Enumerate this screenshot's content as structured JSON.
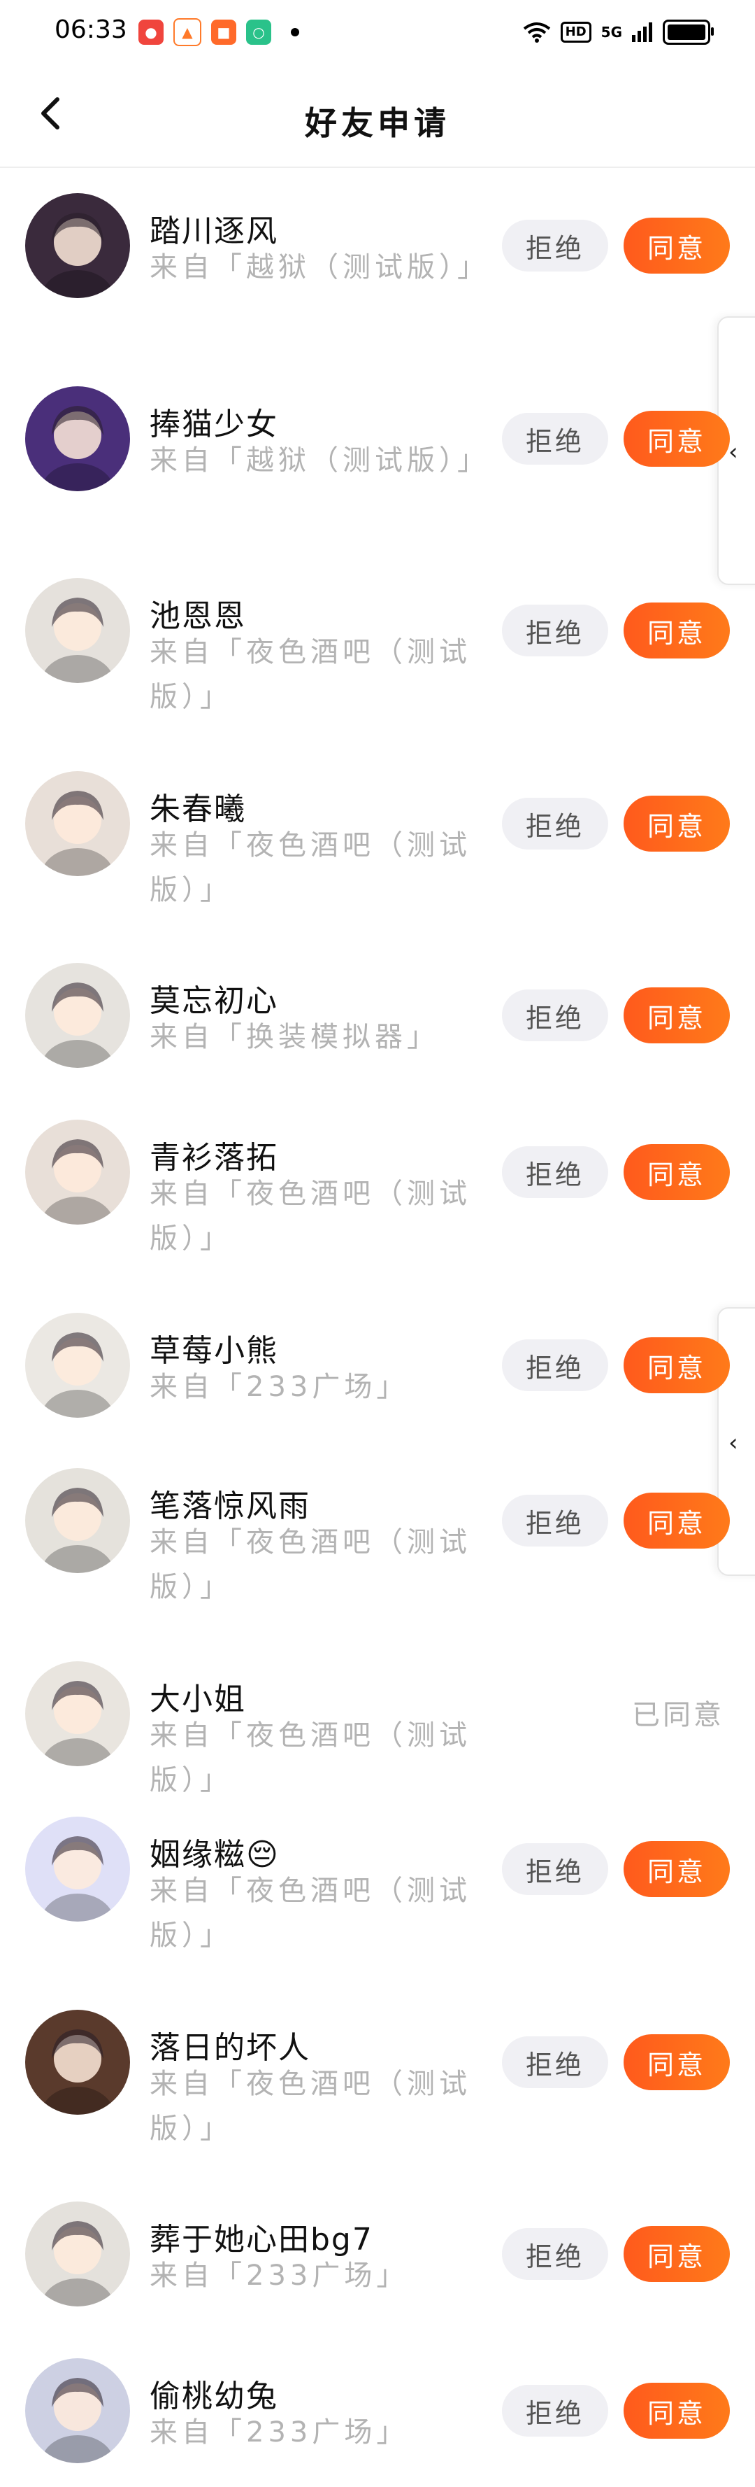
{
  "status": {
    "time": "06:33",
    "network": "5G",
    "hd": "HD"
  },
  "nav": {
    "title": "好友申请"
  },
  "buttons": {
    "reject": "拒绝",
    "agree": "同意"
  },
  "requests": [
    {
      "name": "踏川逐风",
      "source": "来自「越狱（测试版）」",
      "status": "pending",
      "avatar_color": "#3a2a3c"
    },
    {
      "name": "捧猫少女",
      "source": "来自「越狱（测试版）」",
      "status": "pending",
      "avatar_color": "#4a2f7a"
    },
    {
      "name": "池恩恩",
      "source": "来自「夜色酒吧（测试版）」",
      "status": "pending",
      "avatar_color": "#e5e1dc"
    },
    {
      "name": "朱春曦",
      "source": "来自「夜色酒吧（测试版）」",
      "status": "pending",
      "avatar_color": "#e8dfd8"
    },
    {
      "name": "莫忘初心",
      "source": "来自「换装模拟器」",
      "status": "pending",
      "avatar_color": "#e6e3de"
    },
    {
      "name": "青衫落拓",
      "source": "来自「夜色酒吧（测试版）」",
      "status": "pending",
      "avatar_color": "#e8dfd8"
    },
    {
      "name": "草莓小熊",
      "source": "来自「233广场」",
      "status": "pending",
      "avatar_color": "#ebe8e3"
    },
    {
      "name": "笔落惊风雨",
      "source": "来自「夜色酒吧（测试版）」",
      "status": "pending",
      "avatar_color": "#e5e2dc"
    },
    {
      "name": "大小姐",
      "source": "来自「夜色酒吧（测试版）」",
      "status": "agreed",
      "status_text": "已同意",
      "avatar_color": "#e9e5df"
    },
    {
      "name": "姻缘糍😔",
      "source": "来自「夜色酒吧（测试版）」",
      "status": "pending",
      "avatar_color": "#dfe0f7"
    },
    {
      "name": "落日的坏人",
      "source": "来自「夜色酒吧（测试版）」",
      "status": "pending",
      "avatar_color": "#5a3a2c"
    },
    {
      "name": "葬于她心田bg7",
      "source": "来自「233广场」",
      "status": "pending",
      "avatar_color": "#e4e1dc"
    },
    {
      "name": "偷桃幼兔",
      "source": "来自「233广场」",
      "status": "pending",
      "avatar_color": "#cdd0e3"
    }
  ]
}
